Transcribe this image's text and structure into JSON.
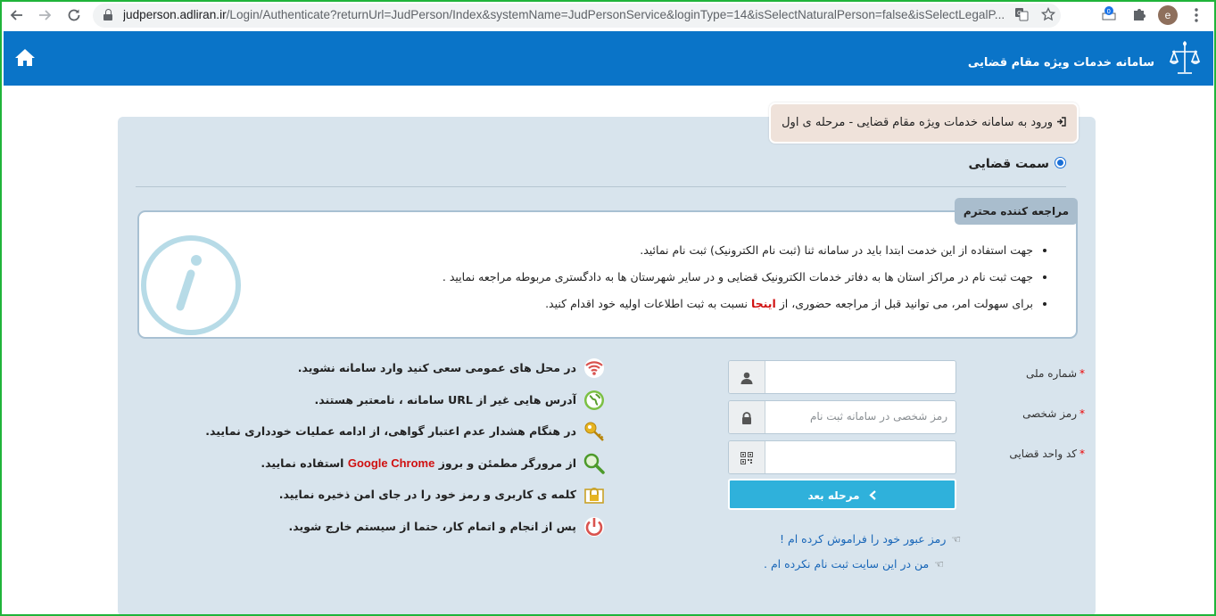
{
  "browser": {
    "url_host": "judperson.adliran.ir",
    "url_path": "/Login/Authenticate?returnUrl=JudPerson/Index&systemName=JudPersonService&loginType=14&isSelectNaturalPerson=false&isSelectLegalP...",
    "profile_initial": "e",
    "icons": [
      "back-icon",
      "forward-icon",
      "reload-icon",
      "lock-icon",
      "translate-icon",
      "star-icon",
      "extension-badge-icon",
      "puzzle-icon",
      "menu-icon"
    ]
  },
  "header": {
    "title": "سامانه خدمات ویژه مقام قضایی",
    "bg_color": "#0a74c8"
  },
  "step": {
    "label": "ورود به سامانه خدمات ویژه مقام قضایی - مرحله ی اول"
  },
  "role": {
    "label": "سمت قضایی",
    "selected": true
  },
  "notice": {
    "tag": "مراجعه کننده محترم",
    "items": [
      "جهت استفاده از این خدمت ابتدا باید در سامانه ثنا (ثبت نام الکترونیک) ثبت نام نمائید.",
      "جهت ثبت نام در مراکز استان ها به دفاتر خدمات الکترونیک قضایی و در سایر شهرستان ها به دادگستری مربوطه مراجعه نمایید ."
    ],
    "item3_before": "برای سهولت امر، می توانید قبل از مراجعه حضوری، از",
    "item3_link": "اینجا",
    "item3_after": "نسبت به ثبت اطلاعات اولیه خود اقدام کنید."
  },
  "tips": [
    {
      "icon": "wifi-icon",
      "text": "در محل های عمومی سعی کنید وارد سامانه نشوید."
    },
    {
      "icon": "globe-icon",
      "text": "آدرس هایی غیر از URL سامانه ، نامعتبر هستند."
    },
    {
      "icon": "key-icon",
      "text": "در هنگام هشدار عدم اعتبار گواهی، از ادامه عملیات خودداری نمایید."
    },
    {
      "icon": "magnifier-icon",
      "before": "از مرورگر مطمئن و بروز",
      "brand": "Google Chrome",
      "after": "استفاده نمایید."
    },
    {
      "icon": "padlock-icon",
      "text": "کلمه ی کاربری و رمز خود را در جای امن ذخیره نمایید."
    },
    {
      "icon": "power-icon",
      "text": "پس از انجام و اتمام کار، حتما از سیستم خارج شوید."
    }
  ],
  "form": {
    "national_id_label": "شماره ملی",
    "national_id_value": "",
    "password_label": "رمز شخصی",
    "password_placeholder": "رمز شخصی در سامانه ثبت نام",
    "judicial_code_label": "کد واحد قضایی",
    "judicial_code_value": "",
    "required_mark": "*",
    "next_button": "مرحله بعد",
    "forgot_link": "رمز عبور خود را فراموش کرده ام !",
    "not_registered_link": "من در این سایت ثبت نام نکرده ام ."
  }
}
